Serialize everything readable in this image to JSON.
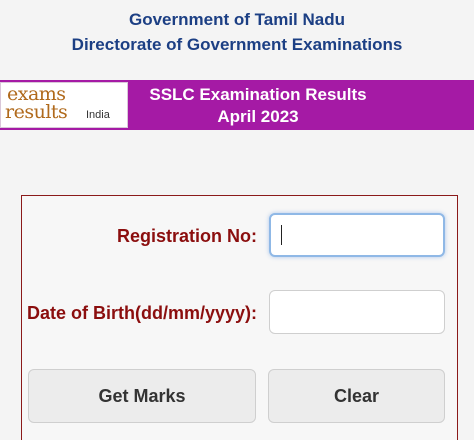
{
  "header": {
    "line1": "Government of Tamil Nadu",
    "line2": "Directorate of Government Examinations"
  },
  "banner": {
    "logo": {
      "word1": "exams",
      "word2": "results",
      "word3": "India"
    },
    "title": "SSLC  Examination Results",
    "subtitle": "April 2023",
    "background": "#a51aa5"
  },
  "form": {
    "registration_label": "Registration No:",
    "registration_value": "",
    "dob_label": "Date of Birth(dd/mm/yyyy):",
    "dob_value": "",
    "get_marks_label": "Get Marks",
    "clear_label": "Clear",
    "label_color": "#8b0e0e",
    "border_color": "#8b1a1a"
  }
}
